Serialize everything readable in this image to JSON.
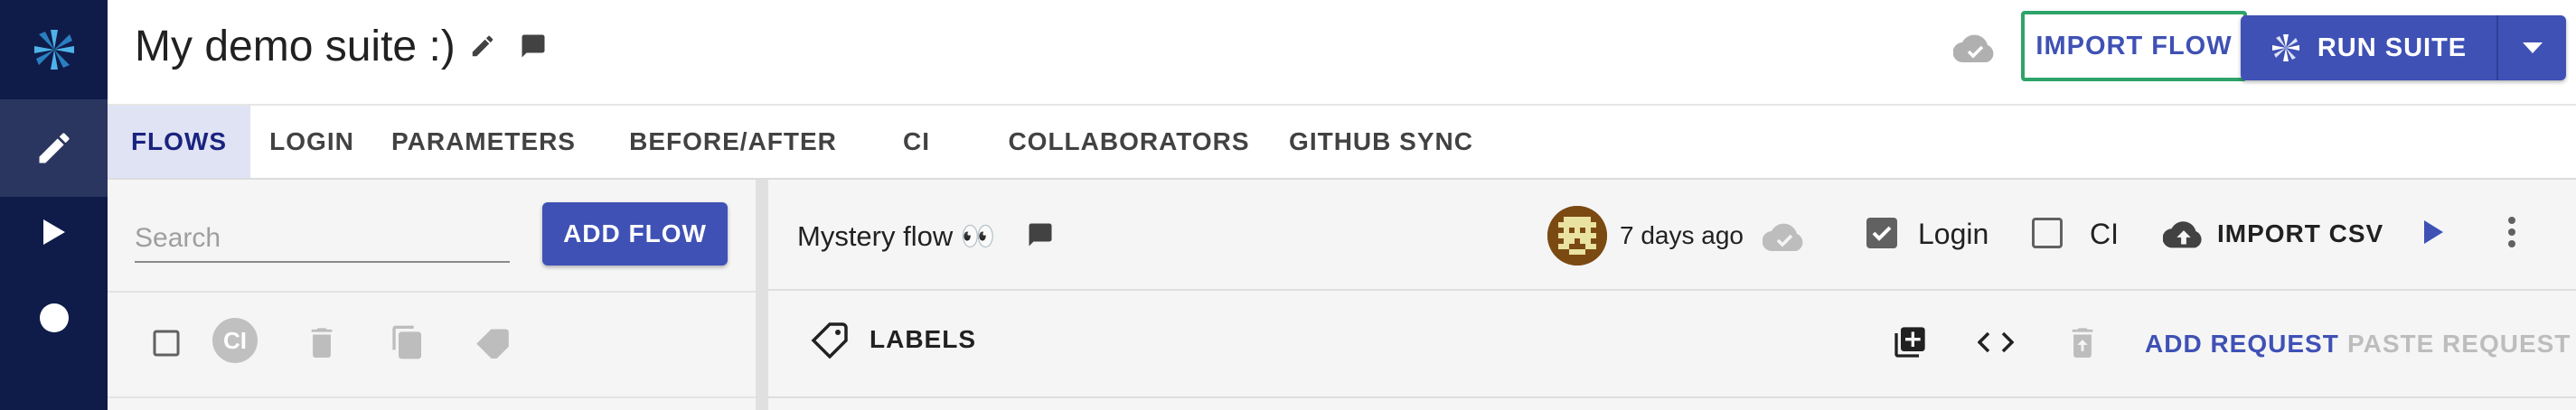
{
  "sidebar": {
    "logo_icon": "pinwheel-logo-icon",
    "items": [
      {
        "icon": "pencil-icon",
        "active": true
      },
      {
        "icon": "play-icon",
        "active": false
      },
      {
        "icon": "record-icon",
        "active": false
      }
    ]
  },
  "header": {
    "title": "My demo suite :)",
    "import_flow_label": "IMPORT FLOW",
    "run_suite_label": "RUN SUITE",
    "colors": {
      "accent": "#3f51b5",
      "highlight": "#2ea36a",
      "sidebar": "#0f1c4a"
    }
  },
  "tabs": [
    {
      "label": "FLOWS",
      "active": true
    },
    {
      "label": "LOGIN",
      "active": false
    },
    {
      "label": "PARAMETERS",
      "active": false
    },
    {
      "label": "BEFORE/AFTER",
      "active": false
    },
    {
      "label": "CI",
      "active": false
    },
    {
      "label": "COLLABORATORS",
      "active": false
    },
    {
      "label": "GITHUB SYNC",
      "active": false
    }
  ],
  "flows_panel": {
    "search_placeholder": "Search",
    "search_value": "",
    "add_flow_label": "ADD FLOW",
    "ci_badge": "CI"
  },
  "flow": {
    "name": "Mystery flow 👀",
    "updated": "7 days ago",
    "login_label": "Login",
    "login_checked": true,
    "ci_label": "CI",
    "ci_checked": false,
    "import_csv_label": "IMPORT CSV",
    "labels_label": "LABELS",
    "add_request_label": "ADD REQUEST",
    "paste_request_label": "PASTE REQUEST"
  }
}
